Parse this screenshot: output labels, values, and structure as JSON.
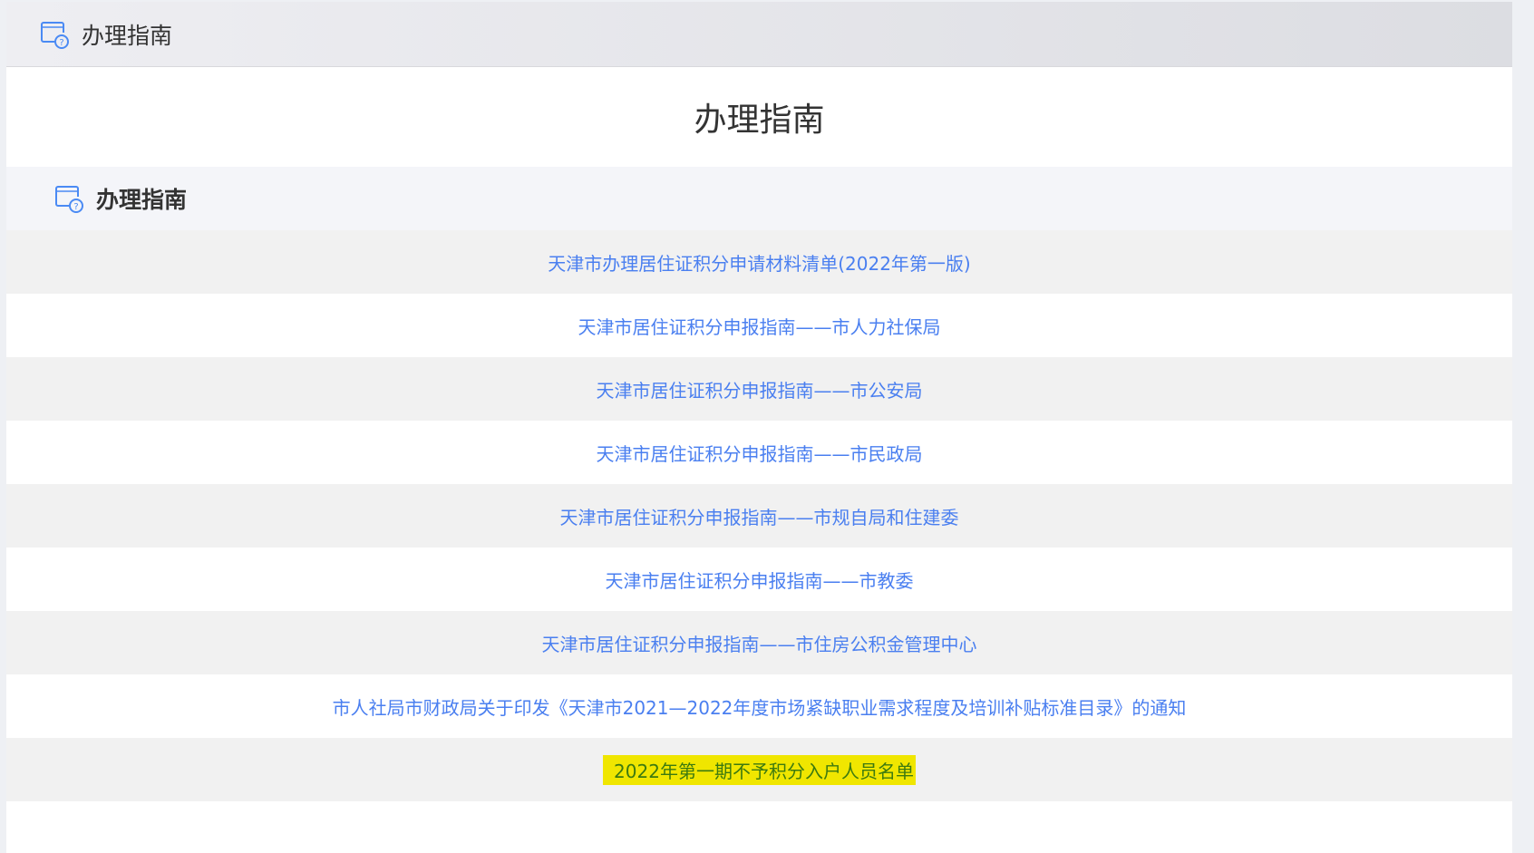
{
  "header": {
    "title": "办理指南"
  },
  "page_title": "办理指南",
  "section": {
    "title": "办理指南"
  },
  "links": [
    "天津市办理居住证积分申请材料清单(2022年第一版)",
    "天津市居住证积分申报指南——市人力社保局",
    "天津市居住证积分申报指南——市公安局",
    "天津市居住证积分申报指南——市民政局",
    "天津市居住证积分申报指南——市规自局和住建委",
    "天津市居住证积分申报指南——市教委",
    "天津市居住证积分申报指南——市住房公积金管理中心",
    "市人社局市财政局关于印发《天津市2021—2022年度市场紧缺职业需求程度及培训补贴标准目录》的通知",
    "2022年第一期不予积分入户人员名单"
  ],
  "colors": {
    "link": "#4a7ff0",
    "highlight": "#f0e600"
  }
}
